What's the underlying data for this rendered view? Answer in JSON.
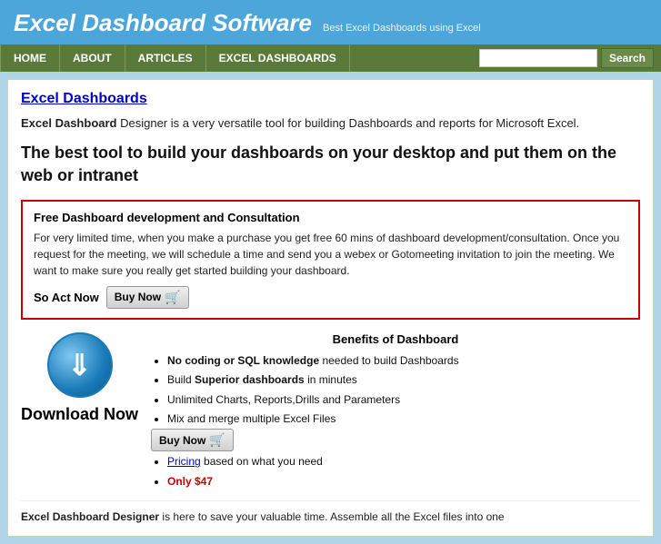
{
  "header": {
    "title": "Excel Dashboard Software",
    "tagline": "Best Excel Dashboards using Excel"
  },
  "navbar": {
    "items": [
      {
        "label": "HOME",
        "id": "nav-home"
      },
      {
        "label": "ABOUT",
        "id": "nav-about"
      },
      {
        "label": "ARTICLES",
        "id": "nav-articles"
      },
      {
        "label": "EXCEL DASHBOARDS",
        "id": "nav-excel-dashboards"
      }
    ],
    "search_placeholder": "",
    "search_button_label": "Search"
  },
  "page": {
    "title": "Excel Dashboards",
    "intro_bold": "Excel Dashboard",
    "intro_rest": " Designer is a very versatile tool for building Dashboards and reports for Microsoft Excel.",
    "hero_heading": "The best tool to build your dashboards on your desktop and put them on the web or intranet",
    "promo": {
      "title": "Free Dashboard development and Consultation",
      "body": "For very limited time, when you make a purchase you get free 60 mins of dashboard development/consultation. Once you request for the meeting, we will schedule a time and send you a webex or Gotomeeting invitation to join the meeting. We want to make sure you really get started building your dashboard.",
      "cta_text": "So Act Now",
      "buy_now_label": "Buy Now"
    },
    "benefits": {
      "heading": "Benefits of Dashboard",
      "items": [
        {
          "text": "No coding or SQL knowledge",
          "bold": "No coding or SQL knowledge",
          "rest": " needed to build Dashboards"
        },
        {
          "text": "Build Superior dashboards in minutes",
          "bold": "Superior dashboards",
          "plain_before": "Build ",
          "plain_after": " in minutes"
        },
        {
          "text": "Unlimited Charts, Reports,Drills and Parameters"
        },
        {
          "text": "Mix and merge multiple Excel Files"
        },
        {
          "is_buy_now": true
        },
        {
          "text": "Pricing based on what you need",
          "link": "Pricing",
          "link_rest": " based on what you need"
        },
        {
          "text": "Only $47",
          "highlight": "Only $47"
        }
      ],
      "buy_now_label": "Buy Now"
    },
    "download": {
      "label": "Download Now"
    },
    "bottom_text": "Excel Dashboard Designer is here to save your valuable time. Assemble all the Excel files into one"
  }
}
